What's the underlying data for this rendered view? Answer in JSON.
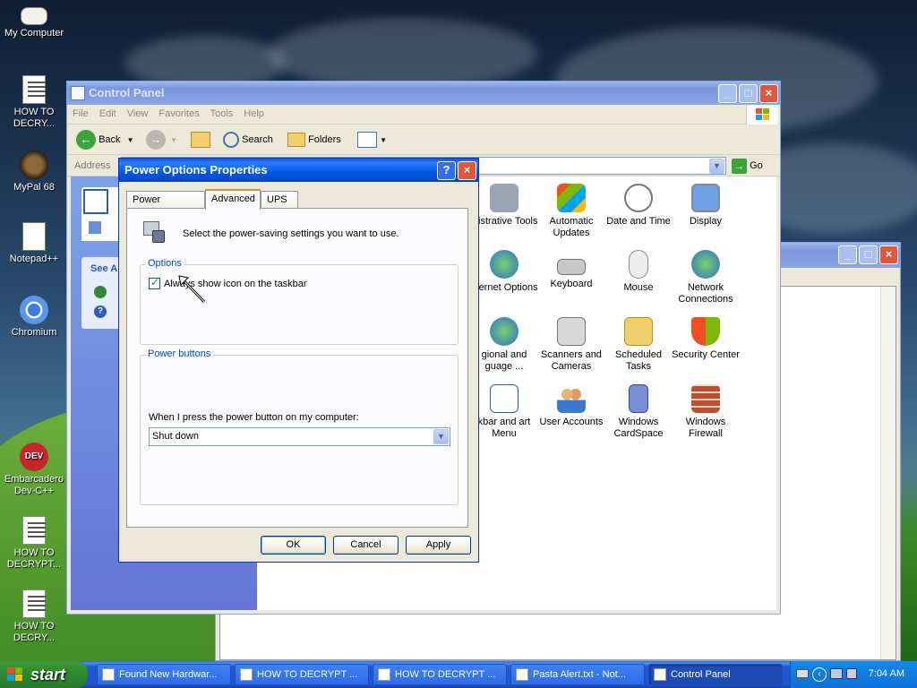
{
  "desktop": {
    "icons": [
      {
        "label": "My Computer"
      },
      {
        "label": "HOW TO DECRY..."
      },
      {
        "label": "MyPal 68"
      },
      {
        "label": "Notepad++"
      },
      {
        "label": "Chromium"
      },
      {
        "label": "Embarcadero Dev-C++"
      },
      {
        "label": "HOW TO DECRYPT..."
      },
      {
        "label": "HOW TO DECRY..."
      }
    ]
  },
  "control_panel": {
    "title": "Control Panel",
    "menu": [
      "File",
      "Edit",
      "View",
      "Favorites",
      "Tools",
      "Help"
    ],
    "toolbar": {
      "back": "Back",
      "search": "Search",
      "folders": "Folders"
    },
    "address_label": "Address",
    "go_label": "Go",
    "sidebar": {
      "see_also": "See A"
    },
    "items": [
      {
        "label": "inistrative Tools",
        "icon": "admin-tools-icon"
      },
      {
        "label": "Automatic Updates",
        "icon": "windows-flag-icon"
      },
      {
        "label": "Date and Time",
        "icon": "clock-icon"
      },
      {
        "label": "Display",
        "icon": "display-icon"
      },
      {
        "label": "nternet Options",
        "icon": "globe-icon"
      },
      {
        "label": "Keyboard",
        "icon": "keyboard-icon"
      },
      {
        "label": "Mouse",
        "icon": "mouse-icon"
      },
      {
        "label": "Network Connections",
        "icon": "network-icon"
      },
      {
        "label": "gional and guage ...",
        "icon": "globe-icon"
      },
      {
        "label": "Scanners and Cameras",
        "icon": "scanner-icon"
      },
      {
        "label": "Scheduled Tasks",
        "icon": "folder-icon"
      },
      {
        "label": "Security Center",
        "icon": "shield-icon"
      },
      {
        "label": "kbar and art Menu",
        "icon": "taskbar-icon"
      },
      {
        "label": "User Accounts",
        "icon": "users-icon"
      },
      {
        "label": "Windows CardSpace",
        "icon": "cardspace-icon"
      },
      {
        "label": "Windows Firewall",
        "icon": "firewall-icon"
      }
    ]
  },
  "dialog": {
    "title": "Power Options Properties",
    "tabs": [
      "Power Schemes",
      "Advanced",
      "UPS"
    ],
    "selected_tab": "Advanced",
    "intro": "Select the power-saving settings you want to use.",
    "options_group": "Options",
    "checkbox_label": "Always show icon on the taskbar",
    "checkbox_checked": true,
    "power_group": "Power buttons",
    "power_prompt": "When I press the power button on my computer:",
    "power_action": "Shut down",
    "buttons": {
      "ok": "OK",
      "cancel": "Cancel",
      "apply": "Apply"
    }
  },
  "taskbar": {
    "start": "start",
    "items": [
      {
        "label": "Found New Hardwar..."
      },
      {
        "label": "HOW TO DECRYPT ..."
      },
      {
        "label": "HOW TO DECRYPT ..."
      },
      {
        "label": "Pasta Alert.txt - Not..."
      },
      {
        "label": "Control Panel"
      }
    ],
    "clock": "7:04 AM"
  }
}
